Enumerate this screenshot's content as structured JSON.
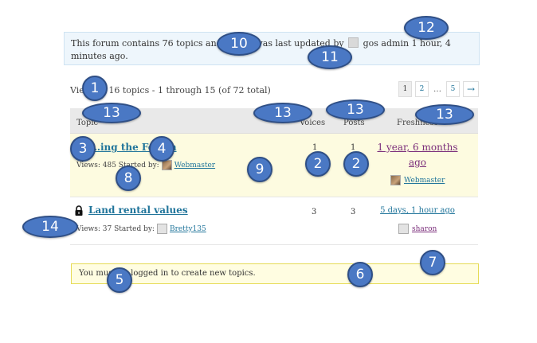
{
  "info": {
    "text_prefix": "This forum contains 76 topics and 4",
    "text_middle": ", and was last updated by",
    "updater": "gos admin",
    "updated_ago": "1 hour, 4",
    "text_suffix": "minutes ago."
  },
  "pagination": {
    "summary": "Viewing 16 topics - 1 through 15 (of 72 total)",
    "pages": [
      "1",
      "2",
      "…",
      "5"
    ],
    "next": "→"
  },
  "table": {
    "headers": {
      "topic": "Topic",
      "voices": "Voices",
      "posts": "Posts",
      "freshness": "Freshness"
    },
    "rows": [
      {
        "title": "…ing the Forum",
        "views_label": "Views: 485 Started by:",
        "author": "Webmaster",
        "voices": "1",
        "posts": "1",
        "freshness": "1 year, 6 months ago",
        "last_by": "Webmaster",
        "sticky": true,
        "locked": false
      },
      {
        "title": "Land rental values",
        "views_label": "Views: 37 Started by:",
        "author": "Bretty135",
        "voices": "3",
        "posts": "3",
        "freshness": "5 days, 1 hour ago",
        "last_by": "sharon",
        "sticky": false,
        "locked": true
      }
    ]
  },
  "notice": {
    "text": "You must be logged in to create new topics."
  },
  "callouts": [
    "1",
    "2",
    "2",
    "3",
    "4",
    "5",
    "6",
    "7",
    "8",
    "9",
    "10",
    "11",
    "12",
    "13",
    "13",
    "13",
    "13",
    "14"
  ],
  "colors": {
    "callout_fill": "#4a78c4",
    "link": "#21759b",
    "visited_link": "#7a2d7a",
    "sticky_bg": "#fdfbe0",
    "notice_bg": "#fffde1"
  }
}
